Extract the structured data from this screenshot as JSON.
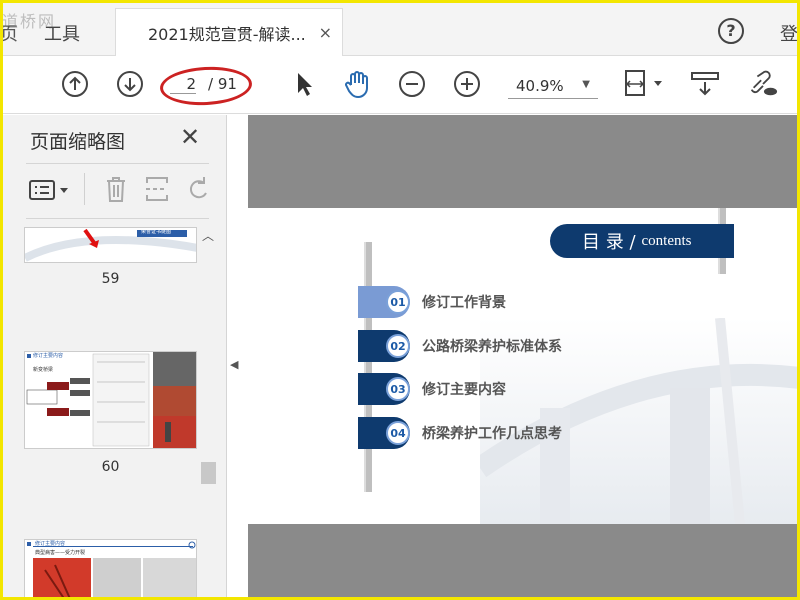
{
  "tabs": {
    "watermark": "道桥网",
    "home_label": "页",
    "tools_label": "工具",
    "document_label": "2021规范宣贯-解读...",
    "close_symbol": "×",
    "help_symbol": "?",
    "login_label": "登"
  },
  "toolbar": {
    "current_page": "2",
    "total_pages": "/ 91",
    "zoom_value": "40.9%",
    "icons": [
      "previous-page-icon",
      "next-page-icon",
      "select-cursor-icon",
      "hand-tool-icon",
      "zoom-out-icon",
      "zoom-in-icon",
      "page-fit-icon",
      "scroll-mode-icon",
      "share-link-icon"
    ]
  },
  "panel": {
    "title": "页面缩略图",
    "close_symbol": "✕",
    "thumbnails": [
      {
        "page": "59"
      },
      {
        "page": "60"
      },
      {
        "page": ""
      }
    ],
    "thumbnail_text": {
      "p59_header": "荣誉证书链图",
      "p60_header": "修订主要内容",
      "p60_title": "新变桥梁",
      "p61_header": "修订主要内容",
      "p61_title": "典型病害——受力开裂"
    }
  },
  "document": {
    "banner_cn": "目 录 /",
    "banner_en": "contents",
    "items": [
      {
        "num": "01",
        "text": "修订工作背景",
        "color": "#7a9bd4"
      },
      {
        "num": "02",
        "text": "公路桥梁养护标准体系",
        "color": "#0e3a6e"
      },
      {
        "num": "03",
        "text": "修订主要内容",
        "color": "#0e3a6e"
      },
      {
        "num": "04",
        "text": "桥梁养护工作几点思考",
        "color": "#0e3a6e"
      }
    ]
  },
  "colors": {
    "accent_navy": "#0e3a6e",
    "highlight_red": "#cc2222",
    "viewer_gray": "#8a8a8a"
  }
}
